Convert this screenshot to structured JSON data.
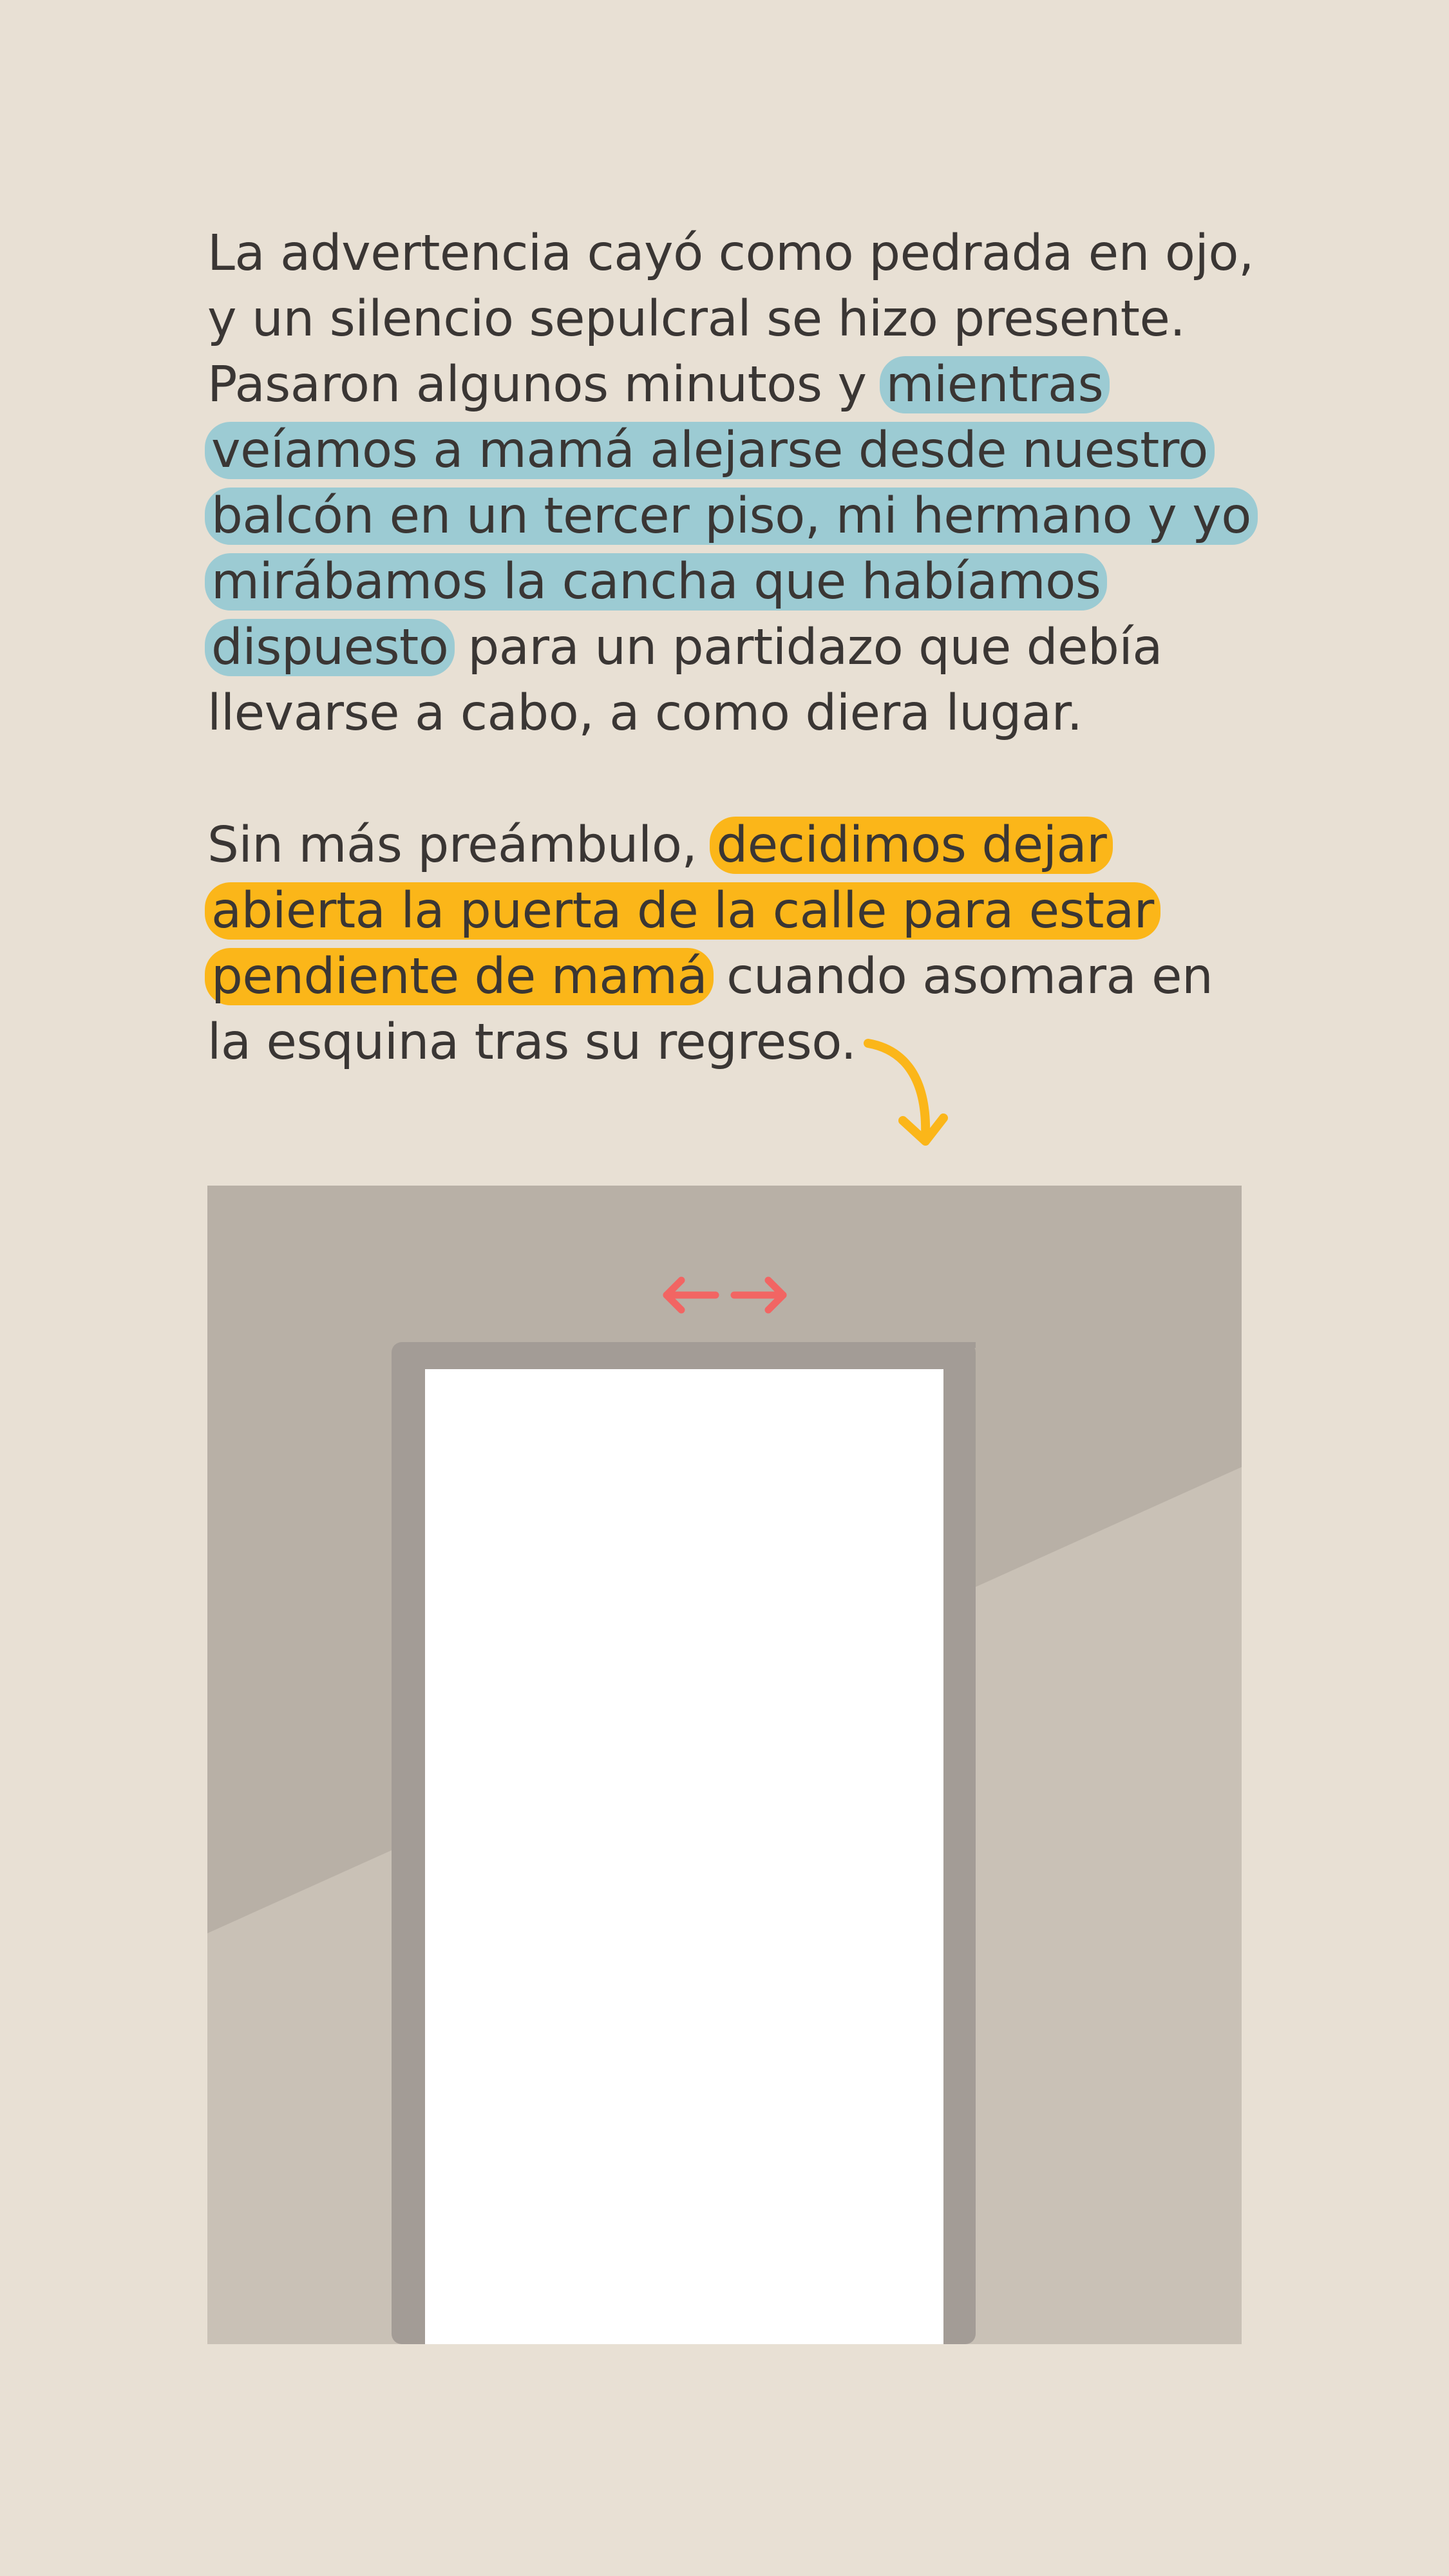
{
  "paragraphs": [
    {
      "before": "La advertencia cayó como pedrada en ojo, y un silencio sepulcral se hizo presente. Pasaron algunos minutos y ",
      "highlight": "mientras veíamos a mamá alejarse desde nuestro balcón en un tercer piso, mi hermano y yo mirábamos la cancha que habíamos dispuesto",
      "after": " para un partidazo que debía llevarse a cabo, a como diera lugar."
    },
    {
      "before": "Sin más preámbulo, ",
      "highlight": "decidimos dejar abierta la puerta de la calle para estar pendiente de mamá",
      "after": " cuando asomara en la esquina tras su regreso."
    }
  ],
  "colors": {
    "background": "#e8e0d4",
    "text": "#3a3634",
    "highlight_blue": "#9ccbd3",
    "highlight_yellow": "#fbb619",
    "wall_dark": "#b8b0a6",
    "wall_light": "#c9c1b6",
    "door_frame": "#a39c96",
    "door_opening": "#ffffff",
    "arrow_red": "#f26563",
    "arrow_yellow": "#fbb619"
  },
  "icons": {
    "pointer_arrow": "curved-down-arrow-icon",
    "width_arrows": "double-horizontal-arrow-icon"
  }
}
